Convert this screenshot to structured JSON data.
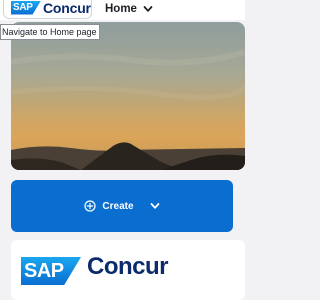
{
  "topbar": {
    "logo": {
      "sap": "SAP",
      "brand": "Concur"
    },
    "home_menu": {
      "label": "Home",
      "icon": "chevron-down-icon"
    },
    "tooltip": "Navigate to Home page"
  },
  "hero": {
    "description_icon": "landscape-image"
  },
  "create_button": {
    "label": "Create",
    "icon": "plus-circle-icon",
    "menu_icon": "chevron-down-icon"
  },
  "logo_card": {
    "sap": "SAP",
    "brand": "Concur"
  },
  "colors": {
    "accent": "#0a6ed1",
    "brand_text": "#0b2b6b",
    "background": "#f2f2f4"
  }
}
